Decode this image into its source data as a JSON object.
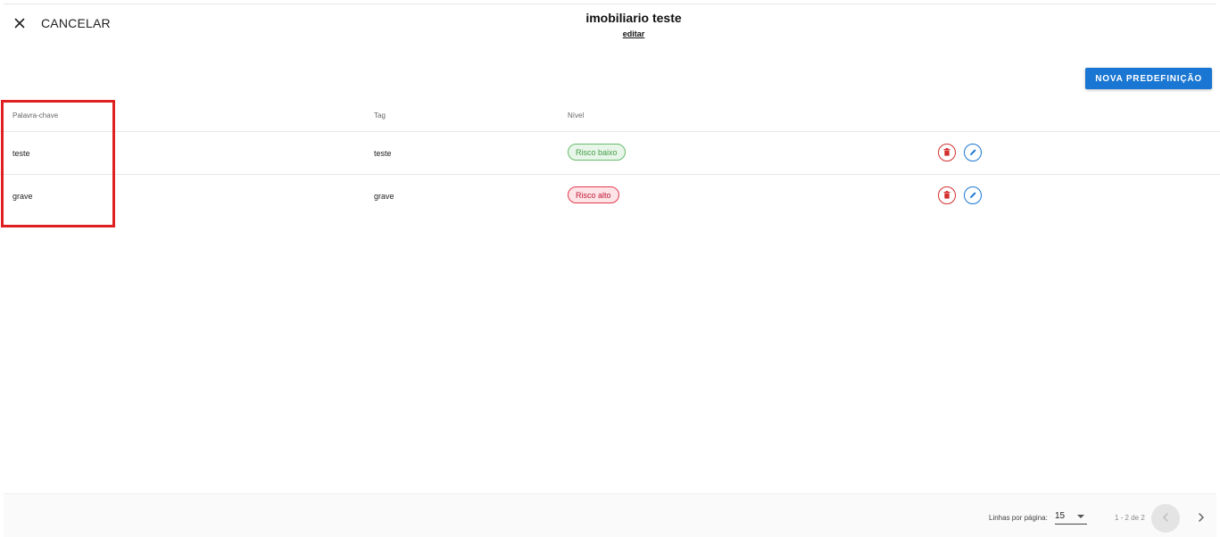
{
  "header": {
    "cancel_label": "CANCELAR",
    "close_icon": "close-icon",
    "title": "imobiliario teste",
    "edit_link": "editar"
  },
  "toolbar": {
    "new_preset_label": "NOVA PREDEFINIÇÃO",
    "accent_color": "#1976d2"
  },
  "table": {
    "columns": [
      "Palavra-chave",
      "Tag",
      "Nível"
    ],
    "rows": [
      {
        "keyword": "teste",
        "tag": "teste",
        "level": "Risco baixo",
        "level_color": "#43a047"
      },
      {
        "keyword": "grave",
        "tag": "grave",
        "level": "Risco alto",
        "level_color": "#c2183a"
      }
    ],
    "row_actions": [
      "delete-icon",
      "edit-icon"
    ]
  },
  "pagination": {
    "rows_per_page_label": "Linhas por página:",
    "rows_per_page_value": "15",
    "range": "1 - 2 de 2",
    "prev_icon": "chevron-left-icon",
    "next_icon": "chevron-right-icon"
  },
  "highlight": {
    "color": "#e02020"
  }
}
